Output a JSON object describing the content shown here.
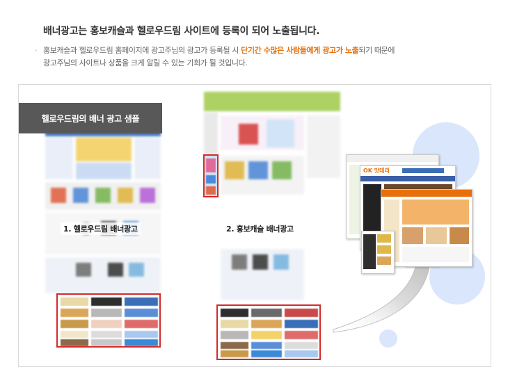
{
  "header": {
    "headline": "배너광고는 홍보캐슬과 헬로우드림 사이트에 등록이 되어 노출됩니다."
  },
  "description": {
    "bullet": "·",
    "line1_before": "홍보캐슬과 헬로우드림 홈페이지에 광고주님의 광고가 등록될 시 ",
    "line1_highlight": "단기간 수많은 사람들에게 광고가 노출",
    "line1_after": "되기 때문에",
    "line2": "광고주님의 사이트나 상품을 크게 알릴 수 있는 기회가 될 것입니다."
  },
  "panel": {
    "sample_tab": "헬로우드림의 배너 광고 샘플",
    "caption_1": "1. 헬로우드림 배너광고",
    "caption_2": "2. 홍보캐슬 배너광고",
    "mini_logo": "OK 맛데리"
  },
  "colors": {
    "highlight": "#e8700c",
    "red_box": "#d42a2a",
    "tab_bg": "#585858",
    "circle": "#d9e6fb"
  }
}
